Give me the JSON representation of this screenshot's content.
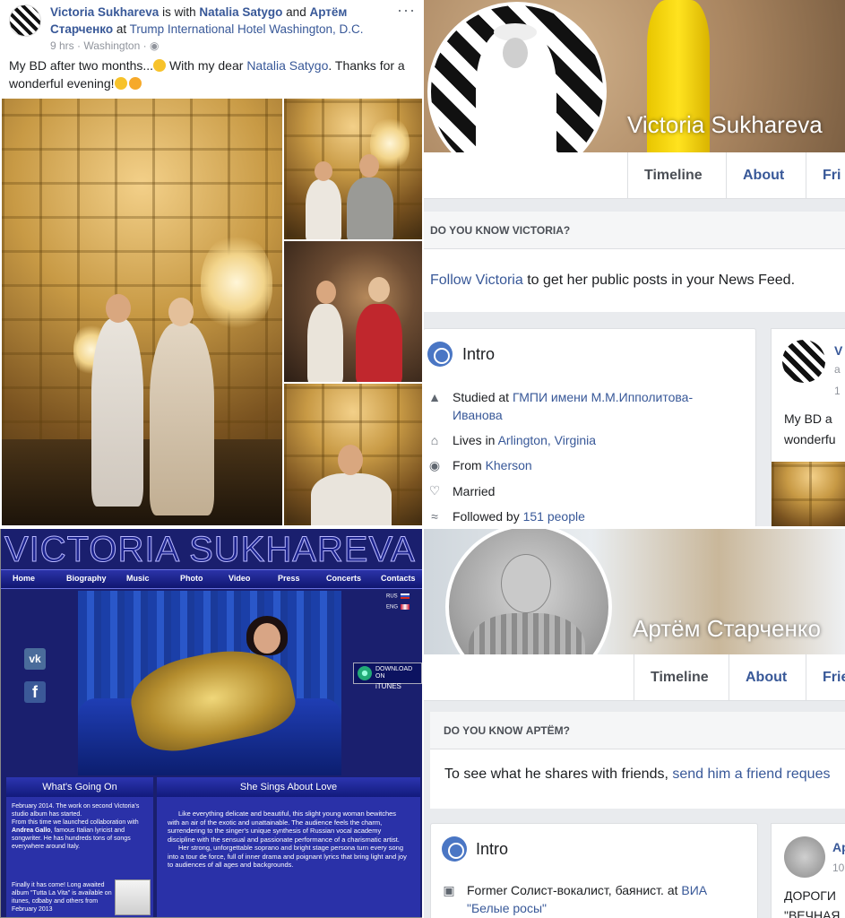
{
  "post": {
    "author": "Victoria Sukhareva",
    "with_text": "is with",
    "tagged_1": "Natalia Satygo",
    "and_text": "and",
    "tagged_2": "Артём Старченко",
    "at_text": "at",
    "place": "Trump International Hotel Washington, D.C.",
    "time": "9 hrs · Washington ·",
    "text_1": "My BD after two months...",
    "text_2": "With my dear",
    "text_mention": "Natalia Satygo",
    "text_3": ". Thanks for a wonderful evening!"
  },
  "victoria_profile": {
    "name": "Victoria Sukhareva",
    "tabs": [
      "Timeline",
      "About",
      "Fri"
    ],
    "know_heading": "DO YOU KNOW VICTORIA?",
    "follow_link": "Follow Victoria",
    "follow_rest": "to get her public posts in your News Feed.",
    "intro_title": "Intro",
    "intro": {
      "studied_prefix": "Studied at",
      "studied_link": "ГМПИ имени М.М.Ипполитова-Иванова",
      "lives_prefix": "Lives in",
      "lives_link": "Arlington, Virginia",
      "from_prefix": "From",
      "from_link": "Kherson",
      "married": "Married",
      "followed_prefix": "Followed by",
      "followed_link": "151 people"
    },
    "side_post": {
      "name_fragment": "V",
      "line_a": "a",
      "line_b": "1",
      "text_1": "My BD a",
      "text_2": "wonderfu"
    }
  },
  "website": {
    "title": "VICTORIA SUKHAREVA",
    "nav": [
      "Home",
      "Biography",
      "Music",
      "Photo",
      "Video",
      "Press",
      "Concerts",
      "Contacts"
    ],
    "lang_1": "RUS",
    "lang_2": "ENG",
    "vk": "vk",
    "fb": "f",
    "itunes_1": "DOWNLOAD",
    "itunes_2": "ON",
    "itunes_3": "iTUNES",
    "news_heading": "What's Going On",
    "news_1": "February 2014. The work on second Victoria's studio album has started.",
    "news_2a": "From this time we launched collaboration with",
    "news_2b": "Andrea Gallo",
    "news_2c": ", famous Italian lyricist and songwriter. He has hundreds tons of songs everywhere around Italy.",
    "news_3": "Finally it has come!  Long awaited album \"Tutta La Vita\" is available on itunes, cdbaby and others  from February 2013",
    "bio_heading": "She Sings About Love",
    "bio_1": "Like everything delicate and beautiful, this slight young woman bewitches with an air of the exotic and unattainable. The audience feels the charm, surrendering to the singer's unique synthesis of Russian vocal academy discipline with the sensual and passionate performance of a charismatic artist.",
    "bio_2": "Her strong, unforgettable soprano and bright stage persona turn every song into a tour de force, full of inner drama and poignant lyrics that bring light and joy to audiences of all ages and backgrounds."
  },
  "artyom_profile": {
    "name": "Артём Старченко",
    "tabs": [
      "Timeline",
      "About",
      "Frie"
    ],
    "know_heading": "DO YOU KNOW АРТЁМ?",
    "see_text": "To see what he shares with friends,",
    "see_link": "send him a friend reques",
    "intro_title": "Intro",
    "former_prefix": "Former Солист-вокалист, баянист. at",
    "former_link": "ВИА \"Белые росы\"",
    "side_post": {
      "name_fragment": "Ар",
      "line_b": "10",
      "text_1": "ДОРОГИ",
      "text_2": "\"ВЕЧНАЯ"
    }
  },
  "colors": {
    "fb_link": "#385898",
    "fb_bg": "#e9ebee",
    "site_bg": "#1a1f6e",
    "site_nav": "#2b33a8"
  }
}
